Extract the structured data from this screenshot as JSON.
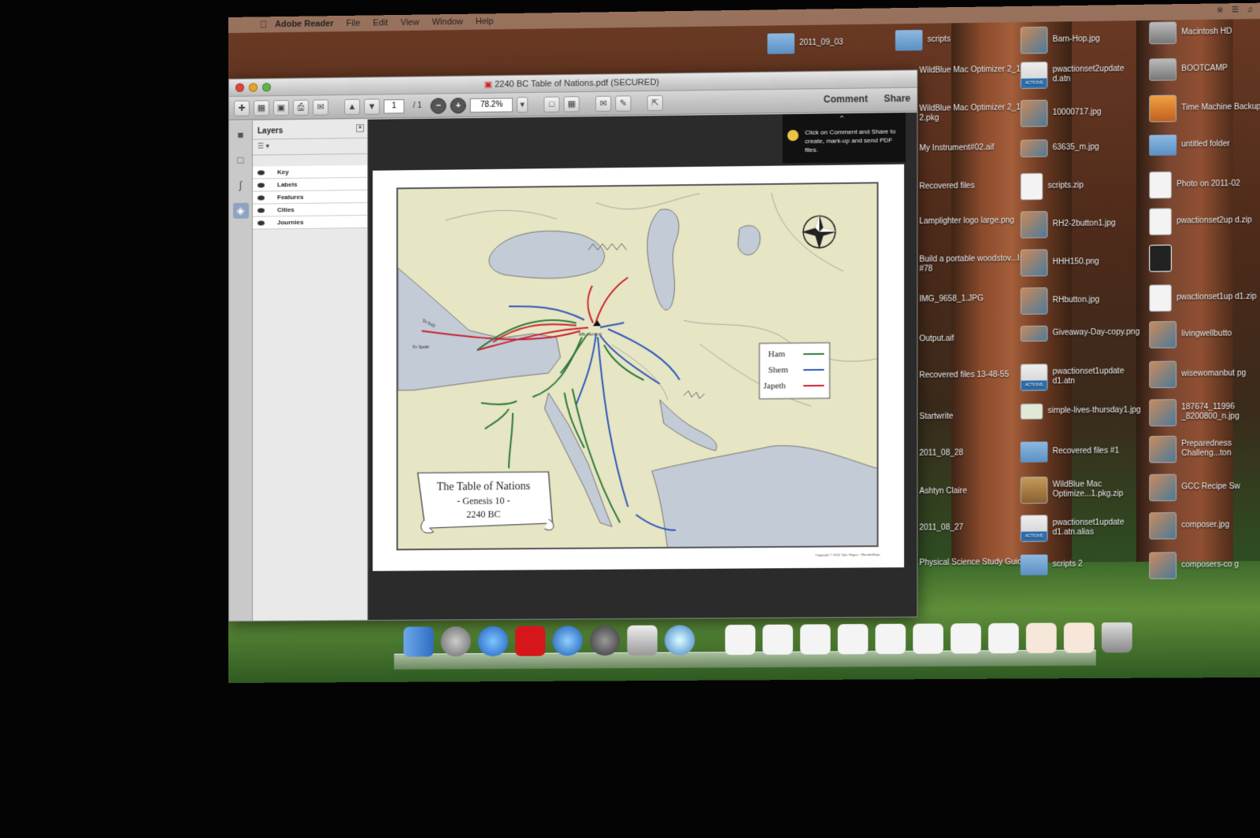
{
  "menubar": {
    "app": "Adobe Reader",
    "items": [
      "File",
      "Edit",
      "View",
      "Window",
      "Help"
    ]
  },
  "window": {
    "title": "2240 BC Table of Nations.pdf (SECURED)"
  },
  "toolbar": {
    "page": "1",
    "total": "/ 1",
    "zoom": "78.2%",
    "comment": "Comment",
    "share": "Share"
  },
  "layers": {
    "title": "Layers",
    "items": [
      "Key",
      "Labels",
      "Features",
      "Cities",
      "Journies"
    ]
  },
  "tip": {
    "text": "Click on Comment and Share to create, mark-up and send PDF files."
  },
  "map": {
    "ararat": "Mt. Ararat",
    "to_italy": "To Italy",
    "to_spain": "To Spain",
    "legend": [
      {
        "name": "Ham",
        "color": "#2e7a3a"
      },
      {
        "name": "Shem",
        "color": "#2f57b8"
      },
      {
        "name": "Japeth",
        "color": "#c8202e"
      }
    ],
    "title": [
      "The Table of Nations",
      "- Genesis 10 -",
      "2240 BC"
    ],
    "copyright": "Copyright © 2010 Tyler Hogan · WonderMaps"
  },
  "desktop": [
    "2011_09_03",
    "scripts",
    "Barn-Hop.jpg",
    "Macintosh HD",
    "WildBlue Mac Optimizer 2_1.pkg",
    "pwactionset2update d.atn",
    "BOOTCAMP",
    "WildBlue Mac Optimizer 2_1 2.pkg",
    "10000717.jpg",
    "Time Machine Backups",
    "My Instrument#02.aif",
    "63635_m.jpg",
    "untitled folder",
    "Recovered files",
    "scripts.zip",
    "Photo on 2011-02",
    "Lamplighter logo large.png",
    "RH2-2button1.jpg",
    "pwactionset2up d.zip",
    "Build a portable woodstov...Issue #78",
    "HHH150.png",
    "",
    "IMG_9658_1.JPG",
    "RHbutton.jpg",
    "pwactionset1up d1.zip",
    "Output.aif",
    "Giveaway-Day-copy.png",
    "livingwellbutto",
    "Recovered files 13-48-55",
    "pwactionset1update d1.atn",
    "wisewomanbut pg",
    "Startwrite",
    "simple-lives-thursday1.jpg",
    "187674_11996 _8200800_n.jpg",
    "2011_08_28",
    "Recovered files #1",
    "Preparedness Challeng...ton",
    "Ashtyn Claire",
    "WildBlue Mac Optimize...1.pkg.zip",
    "GCC Recipe Sw",
    "2011_08_27",
    "pwactionset1update d1.atn.alias",
    "composer.jpg",
    "Physical Science Study Guides",
    "scripts 2",
    "composers-co g"
  ]
}
